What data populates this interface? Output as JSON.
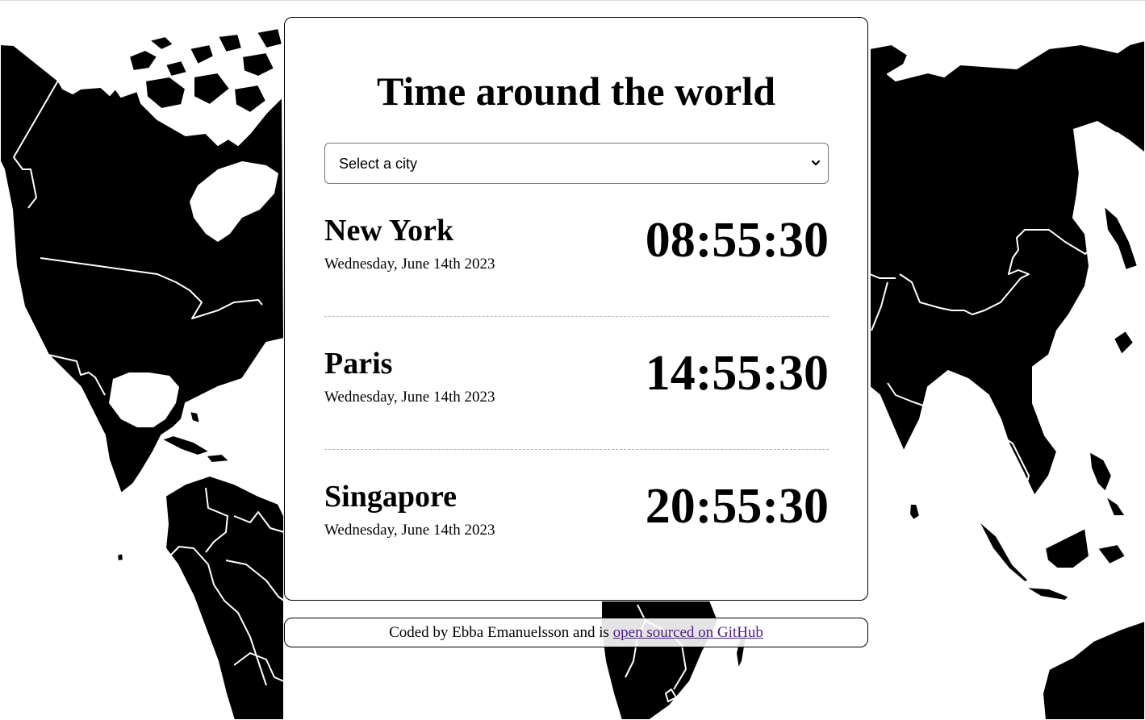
{
  "page": {
    "title": "Time around the world"
  },
  "city_select": {
    "selected_label": "Select a city",
    "icon": "chevron-down-icon"
  },
  "cities": [
    {
      "name": "New York",
      "date": "Wednesday, June 14th 2023",
      "time": "08:55:30"
    },
    {
      "name": "Paris",
      "date": "Wednesday, June 14th 2023",
      "time": "14:55:30"
    },
    {
      "name": "Singapore",
      "date": "Wednesday, June 14th 2023",
      "time": "20:55:30"
    }
  ],
  "footer": {
    "text": "Coded by Ebba Emanuelsson and is ",
    "link_label": "open sourced on GitHub",
    "link_color": "#4b1a94"
  },
  "background": {
    "description": "world map",
    "land_color": "#000000",
    "border_color": "#ffffff"
  }
}
